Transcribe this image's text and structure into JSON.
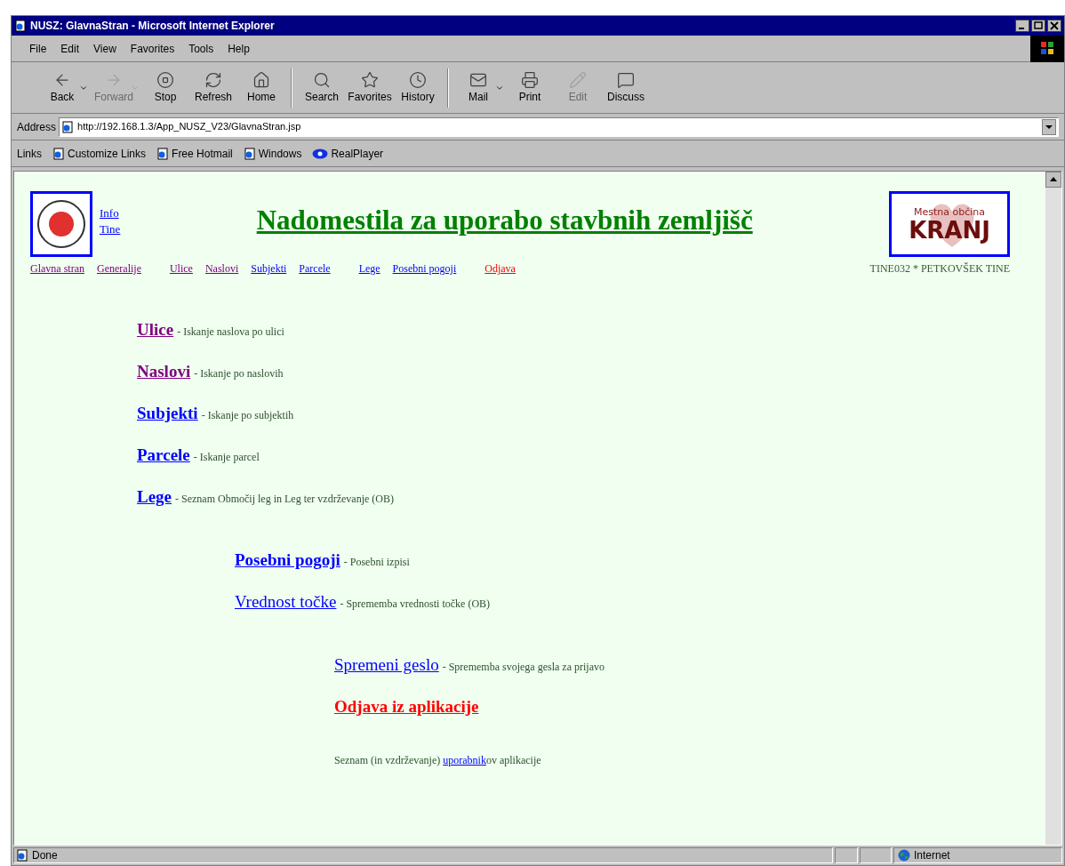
{
  "window": {
    "title": "NUSZ: GlavnaStran - Microsoft Internet Explorer"
  },
  "menu": [
    "File",
    "Edit",
    "View",
    "Favorites",
    "Tools",
    "Help"
  ],
  "toolbar": [
    {
      "label": "Back",
      "kind": "back",
      "disabled": false,
      "dropdown": true
    },
    {
      "label": "Forward",
      "kind": "forward",
      "disabled": true,
      "dropdown": true
    },
    {
      "label": "Stop",
      "kind": "stop",
      "disabled": false,
      "dropdown": false
    },
    {
      "label": "Refresh",
      "kind": "refresh",
      "disabled": false,
      "dropdown": false
    },
    {
      "label": "Home",
      "kind": "home",
      "disabled": false,
      "dropdown": false
    },
    {
      "kind": "separator"
    },
    {
      "label": "Search",
      "kind": "search",
      "disabled": false,
      "dropdown": false
    },
    {
      "label": "Favorites",
      "kind": "favorites",
      "disabled": false,
      "dropdown": false
    },
    {
      "label": "History",
      "kind": "history",
      "disabled": false,
      "dropdown": false
    },
    {
      "kind": "separator"
    },
    {
      "label": "Mail",
      "kind": "mail",
      "disabled": false,
      "dropdown": true
    },
    {
      "label": "Print",
      "kind": "print",
      "disabled": false,
      "dropdown": false
    },
    {
      "label": "Edit",
      "kind": "edit",
      "disabled": true,
      "dropdown": false
    },
    {
      "label": "Discuss",
      "kind": "discuss",
      "disabled": false,
      "dropdown": false
    }
  ],
  "address": {
    "label": "Address",
    "value": "http://192.168.1.3/App_NUSZ_V23/GlavnaStran.jsp"
  },
  "links_bar": {
    "label": "Links",
    "items": [
      {
        "label": "Customize Links",
        "kind": "page"
      },
      {
        "label": "Free Hotmail",
        "kind": "page"
      },
      {
        "label": "Windows",
        "kind": "page"
      },
      {
        "label": "RealPlayer",
        "kind": "real"
      }
    ]
  },
  "page": {
    "side_links": [
      "Info",
      "Tine"
    ],
    "heading": "Nadomestila za uporabo stavbnih zemljišč",
    "logo": {
      "line1": "Mestna občina",
      "line2": "KRANJ"
    },
    "nav": [
      {
        "label": "Glavna stran",
        "kind": "visited"
      },
      {
        "label": "Generalije",
        "kind": "visited"
      },
      {
        "label": "Ulice",
        "kind": "visited"
      },
      {
        "label": "Naslovi",
        "kind": "visited"
      },
      {
        "label": "Subjekti",
        "kind": "link"
      },
      {
        "label": "Parcele",
        "kind": "link"
      },
      {
        "label": "Lege",
        "kind": "link"
      },
      {
        "label": "Posebni pogoji",
        "kind": "link"
      },
      {
        "label": "Odjava",
        "kind": "logout"
      }
    ],
    "user": "TINE032 * PETKOVŠEK TINE",
    "groups": [
      {
        "items": [
          {
            "link": "Ulice",
            "kind": "visited",
            "bold": true,
            "description": "- Iskanje naslova po ulici"
          },
          {
            "link": "Naslovi",
            "kind": "visited",
            "bold": true,
            "description": "- Iskanje po naslovih"
          },
          {
            "link": "Subjekti",
            "kind": "link",
            "bold": true,
            "description": "- Iskanje po subjektih"
          },
          {
            "link": "Parcele",
            "kind": "link",
            "bold": true,
            "description": "- Iskanje parcel"
          },
          {
            "link": "Lege",
            "kind": "link",
            "bold": true,
            "description": "- Seznam Območij leg in Leg ter vzdrževanje (OB)"
          }
        ]
      },
      {
        "items": [
          {
            "link": "Posebni pogoji",
            "kind": "link",
            "bold": true,
            "description": "- Posebni izpisi"
          },
          {
            "link": "Vrednost točke",
            "kind": "link",
            "bold": false,
            "description": "- Sprememba vrednosti točke (OB)"
          }
        ]
      },
      {
        "items": [
          {
            "link": "Spremeni geslo",
            "kind": "link",
            "bold": false,
            "description": "- Sprememba svojega gesla za prijavo"
          },
          {
            "link": "Odjava iz aplikacije",
            "kind": "logout",
            "bold": true
          }
        ]
      }
    ],
    "footer": {
      "before": "Seznam (in vzdrževanje) ",
      "link": "uporabnik",
      "after": "ov aplikacije"
    }
  },
  "status_bar": {
    "text": "Done",
    "zone": "Internet"
  }
}
